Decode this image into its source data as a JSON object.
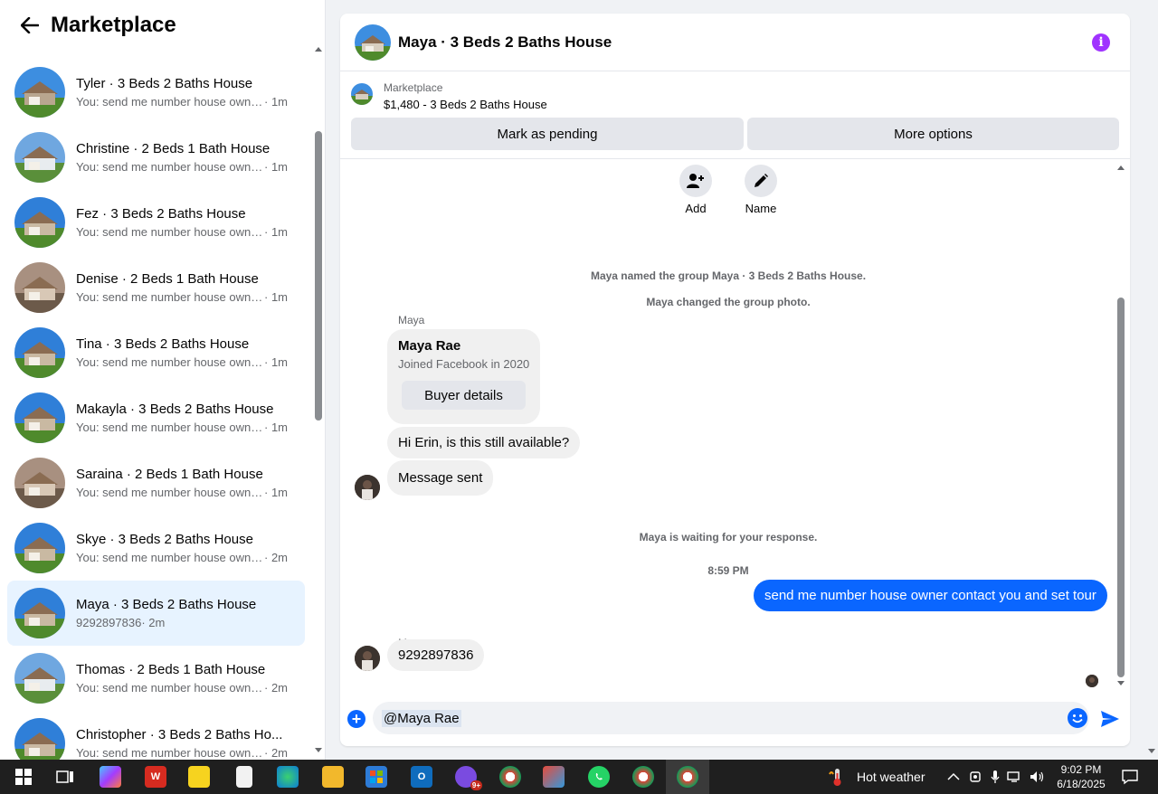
{
  "sidebar": {
    "title": "Marketplace",
    "conversations": [
      {
        "name": "Tyler · 3 Beds 2 Baths House",
        "preview": "You: send me number house owne...",
        "time": " · 1m"
      },
      {
        "name": "Christine · 2 Beds 1 Bath House",
        "preview": "You: send me number house owne...",
        "time": " · 1m"
      },
      {
        "name": "Fez · 3 Beds 2 Baths House",
        "preview": "You: send me number house owne...",
        "time": " · 1m"
      },
      {
        "name": "Denise · 2 Beds 1 Bath House",
        "preview": "You: send me number house owne...",
        "time": " · 1m"
      },
      {
        "name": "Tina · 3 Beds 2 Baths House",
        "preview": "You: send me number house owne...",
        "time": " · 1m"
      },
      {
        "name": "Makayla · 3 Beds 2 Baths House",
        "preview": "You: send me number house owne...",
        "time": " · 1m"
      },
      {
        "name": "Saraina · 2 Beds 1 Bath House",
        "preview": "You: send me number house owne...",
        "time": " · 1m"
      },
      {
        "name": "Skye · 3 Beds 2 Baths House",
        "preview": "You: send me number house owne...",
        "time": " · 2m"
      },
      {
        "name": "Maya · 3 Beds 2 Baths House",
        "preview": "9292897836",
        "time": " · 2m"
      },
      {
        "name": "Thomas · 2 Beds 1 Bath House",
        "preview": "You: send me number house owne...",
        "time": " · 2m"
      },
      {
        "name": "Christopher · 3 Beds 2 Baths Ho...",
        "preview": "You: send me number house owne...",
        "time": " · 2m"
      }
    ]
  },
  "chat": {
    "title": "Maya · 3 Beds 2 Baths House",
    "info_icon": "i",
    "listing": {
      "source": "Marketplace",
      "detail": "$1,480 - 3 Beds 2 Baths House",
      "pending_label": "Mark as pending",
      "more_label": "More options"
    },
    "actions": {
      "add_label": "Add",
      "name_label": "Name"
    },
    "system": {
      "named": "Maya named the group Maya · 3 Beds 2 Baths House.",
      "photo": "Maya changed the group photo.",
      "waiting": "Maya is waiting for your response."
    },
    "sender": "Maya",
    "card": {
      "name": "Maya Rae",
      "joined": "Joined Facebook in 2020",
      "button": "Buyer details"
    },
    "msg1": "Hi Erin, is this still available?",
    "msg2": "Message sent",
    "timestamp": "8:59 PM",
    "outgoing": "send me number house owner contact you and set tour",
    "reply": "9292897836",
    "composer_mention": "@Maya Rae",
    "plus_icon": "+"
  },
  "taskbar": {
    "weather": "Hot weather",
    "time": "9:02 PM",
    "date": "6/18/2025",
    "badge": "9+"
  },
  "colors": {
    "accent": "#0a66ff",
    "active_item": "#e7f3ff",
    "info": "#a033ff"
  }
}
